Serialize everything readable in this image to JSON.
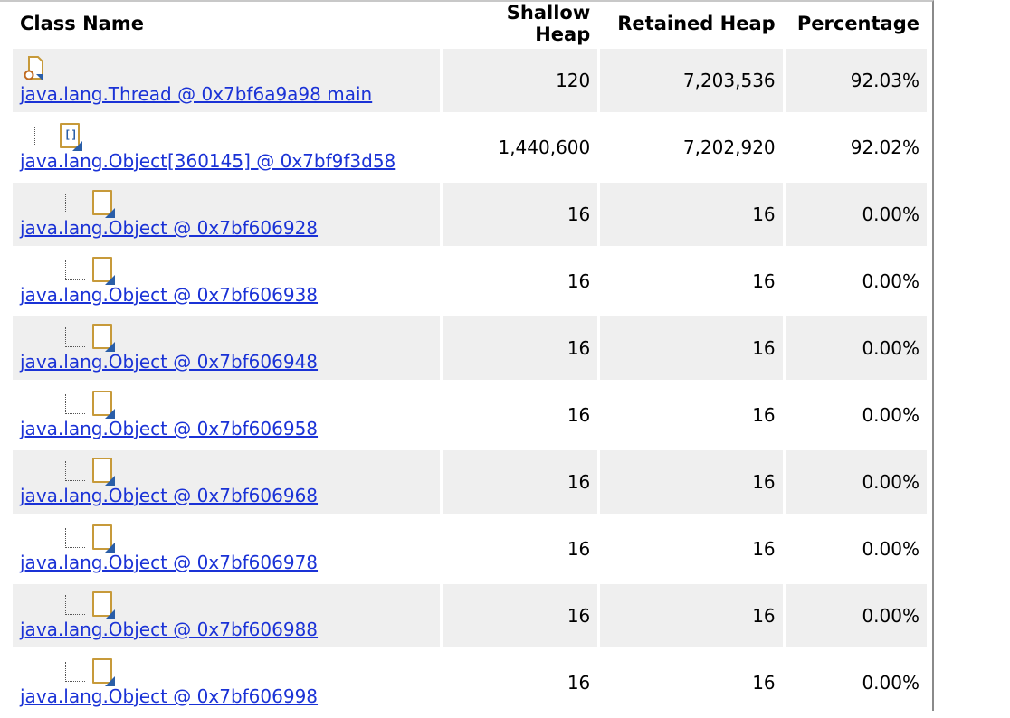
{
  "table": {
    "headers": [
      "Class Name",
      "Shallow Heap",
      "Retained Heap",
      "Percentage"
    ],
    "rows": [
      {
        "name": "java.lang.Thread @ 0x7bf6a9a98 main",
        "shallow": "120",
        "retained": "7,203,536",
        "pct": "92.03%",
        "icon": "thread-icon",
        "depth": 0
      },
      {
        "name": "java.lang.Object[360145] @ 0x7bf9f3d58",
        "shallow": "1,440,600",
        "retained": "7,202,920",
        "pct": "92.02%",
        "icon": "object-array-icon",
        "depth": 1
      },
      {
        "name": "java.lang.Object @ 0x7bf606928",
        "shallow": "16",
        "retained": "16",
        "pct": "0.00%",
        "icon": "object-icon",
        "depth": 2
      },
      {
        "name": "java.lang.Object @ 0x7bf606938",
        "shallow": "16",
        "retained": "16",
        "pct": "0.00%",
        "icon": "object-icon",
        "depth": 2
      },
      {
        "name": "java.lang.Object @ 0x7bf606948",
        "shallow": "16",
        "retained": "16",
        "pct": "0.00%",
        "icon": "object-icon",
        "depth": 2
      },
      {
        "name": "java.lang.Object @ 0x7bf606958",
        "shallow": "16",
        "retained": "16",
        "pct": "0.00%",
        "icon": "object-icon",
        "depth": 2
      },
      {
        "name": "java.lang.Object @ 0x7bf606968",
        "shallow": "16",
        "retained": "16",
        "pct": "0.00%",
        "icon": "object-icon",
        "depth": 2
      },
      {
        "name": "java.lang.Object @ 0x7bf606978",
        "shallow": "16",
        "retained": "16",
        "pct": "0.00%",
        "icon": "object-icon",
        "depth": 2
      },
      {
        "name": "java.lang.Object @ 0x7bf606988",
        "shallow": "16",
        "retained": "16",
        "pct": "0.00%",
        "icon": "object-icon",
        "depth": 2
      },
      {
        "name": "java.lang.Object @ 0x7bf606998",
        "shallow": "16",
        "retained": "16",
        "pct": "0.00%",
        "icon": "object-icon",
        "depth": 2
      }
    ]
  },
  "colors": {
    "link": "#1a32d6",
    "row_alt": "#efefef",
    "icon_border": "#c79a3a",
    "icon_corner": "#2a5ea8"
  }
}
